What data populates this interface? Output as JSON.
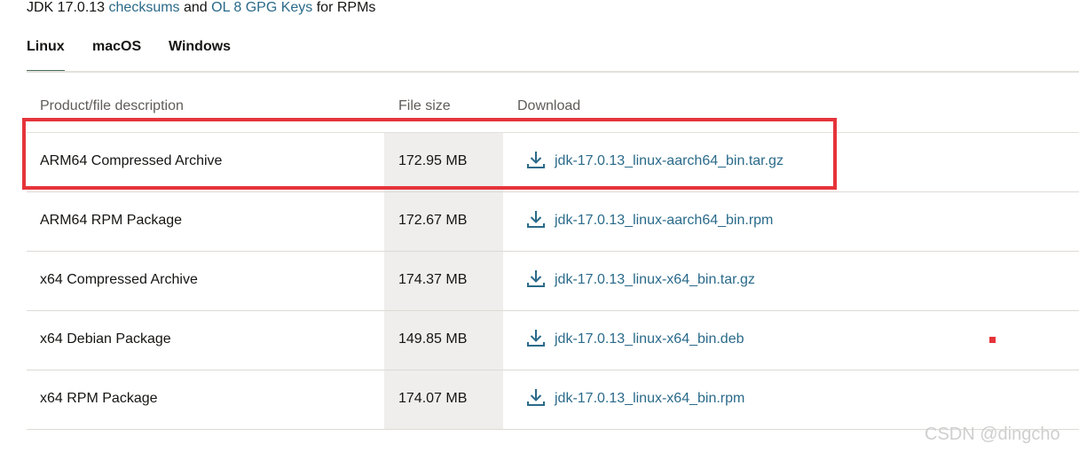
{
  "intro": {
    "prefix": "JDK 17.0.13",
    "checksums_link": "checksums",
    "and_text": "and",
    "gpg_link": "OL 8 GPG Keys",
    "suffix": "for RPMs"
  },
  "tabs": [
    {
      "label": "Linux",
      "active": true
    },
    {
      "label": "macOS",
      "active": false
    },
    {
      "label": "Windows",
      "active": false
    }
  ],
  "table": {
    "headers": [
      "Product/file description",
      "File size",
      "Download"
    ],
    "rows": [
      {
        "description": "ARM64 Compressed Archive",
        "size": "172.95 MB",
        "file": "jdk-17.0.13_linux-aarch64_bin.tar.gz"
      },
      {
        "description": "ARM64 RPM Package",
        "size": "172.67 MB",
        "file": "jdk-17.0.13_linux-aarch64_bin.rpm"
      },
      {
        "description": "x64 Compressed Archive",
        "size": "174.37 MB",
        "file": "jdk-17.0.13_linux-x64_bin.tar.gz"
      },
      {
        "description": "x64 Debian Package",
        "size": "149.85 MB",
        "file": "jdk-17.0.13_linux-x64_bin.deb"
      },
      {
        "description": "x64 RPM Package",
        "size": "174.07 MB",
        "file": "jdk-17.0.13_linux-x64_bin.rpm"
      }
    ],
    "download_icon": "download-icon"
  },
  "annotation": {
    "highlighted_row": 0,
    "color": "#e5343a"
  },
  "watermark": "CSDN @dingcho",
  "colors": {
    "link": "#2a6a8a",
    "tab_active_underline": "#4e6e5d",
    "size_column_bg": "#efeeec"
  }
}
